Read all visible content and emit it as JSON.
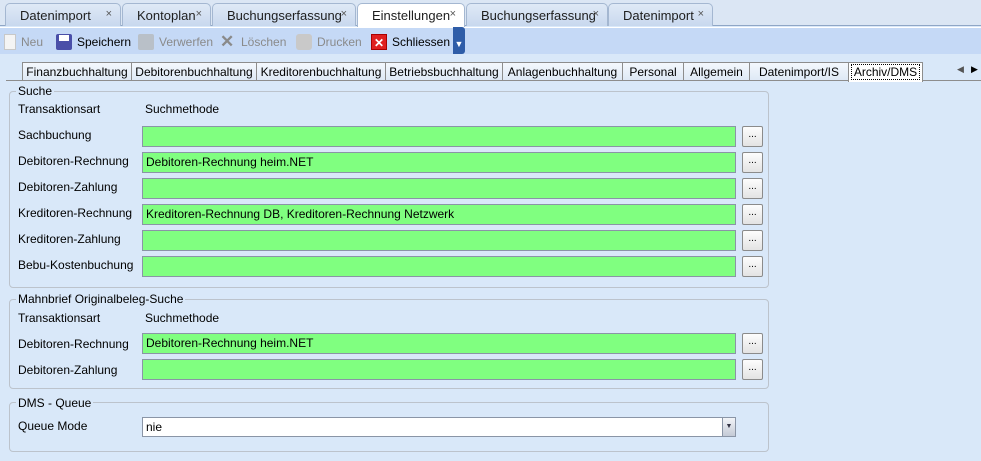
{
  "doc_tabs": [
    {
      "label": "Datenimport",
      "active": false
    },
    {
      "label": "Kontoplan",
      "active": false
    },
    {
      "label": "Buchungserfassung",
      "active": false
    },
    {
      "label": "Einstellungen",
      "active": true
    },
    {
      "label": "Buchungserfassung",
      "active": false
    },
    {
      "label": "Datenimport",
      "active": false
    }
  ],
  "close_glyph": "×",
  "toolbar": {
    "new": "Neu",
    "save": "Speichern",
    "discard": "Verwerfen",
    "delete": "Löschen",
    "print": "Drucken",
    "close": "Schliessen"
  },
  "settings_tabs": [
    "Finanzbuchhaltung",
    "Debitorenbuchhaltung",
    "Kreditorenbuchhaltung",
    "Betriebsbuchhaltung",
    "Anlagenbuchhaltung",
    "Personal",
    "Allgemein",
    "Datenimport/IS",
    "Archiv/DMS"
  ],
  "active_settings_tab": "Archiv/DMS",
  "search": {
    "title": "Suche",
    "col1": "Transaktionsart",
    "col2": "Suchmethode",
    "rows": [
      {
        "label": "Sachbuchung",
        "value": ""
      },
      {
        "label": "Debitoren-Rechnung",
        "value": "Debitoren-Rechnung heim.NET"
      },
      {
        "label": "Debitoren-Zahlung",
        "value": ""
      },
      {
        "label": "Kreditoren-Rechnung",
        "value": "Kreditoren-Rechnung DB, Kreditoren-Rechnung Netzwerk"
      },
      {
        "label": "Kreditoren-Zahlung",
        "value": ""
      },
      {
        "label": "Bebu-Kostenbuchung",
        "value": ""
      }
    ]
  },
  "dunning": {
    "title": "Mahnbrief Originalbeleg-Suche",
    "col1": "Transaktionsart",
    "col2": "Suchmethode",
    "rows": [
      {
        "label": "Debitoren-Rechnung",
        "value": "Debitoren-Rechnung heim.NET"
      },
      {
        "label": "Debitoren-Zahlung",
        "value": ""
      }
    ]
  },
  "dms": {
    "title": "DMS - Queue",
    "label": "Queue Mode",
    "value": "nie"
  },
  "browse_label": "...",
  "colors": {
    "field_green": "#80ff80",
    "background": "#d9e8f9",
    "toolbar": "#c5d9f6"
  }
}
